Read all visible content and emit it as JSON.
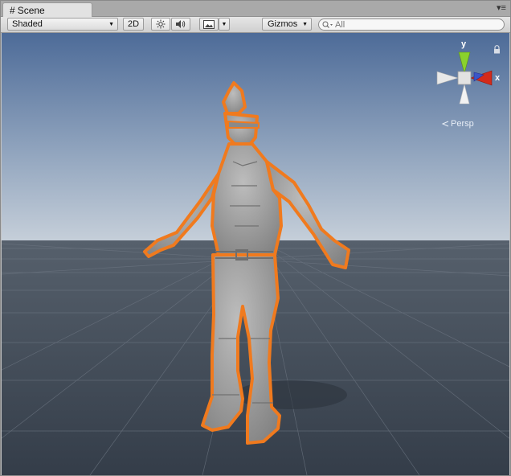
{
  "window": {
    "tab_title": "Scene",
    "tab_icon": "hash-icon",
    "menu_icon": "tab-menu-icon"
  },
  "toolbar": {
    "draw_mode": "Shaded",
    "mode_2d_label": "2D",
    "lighting_icon": "sun-icon",
    "audio_icon": "speaker-icon",
    "effects_icon": "image-icon",
    "gizmos_label": "Gizmos",
    "search_placeholder": "All"
  },
  "orientation_gizmo": {
    "y_label": "y",
    "x_label": "x",
    "projection_label": "Persp",
    "colors": {
      "y": "#8ad22c",
      "x": "#d42a1a",
      "neutral": "#e2e2e2"
    }
  },
  "scene": {
    "selection_outline_color": "#f07a1e",
    "sky_top": "#4d6b98",
    "sky_horizon": "#c7d0da",
    "ground": "#3f4855",
    "model_color": "#9a9a9a"
  }
}
